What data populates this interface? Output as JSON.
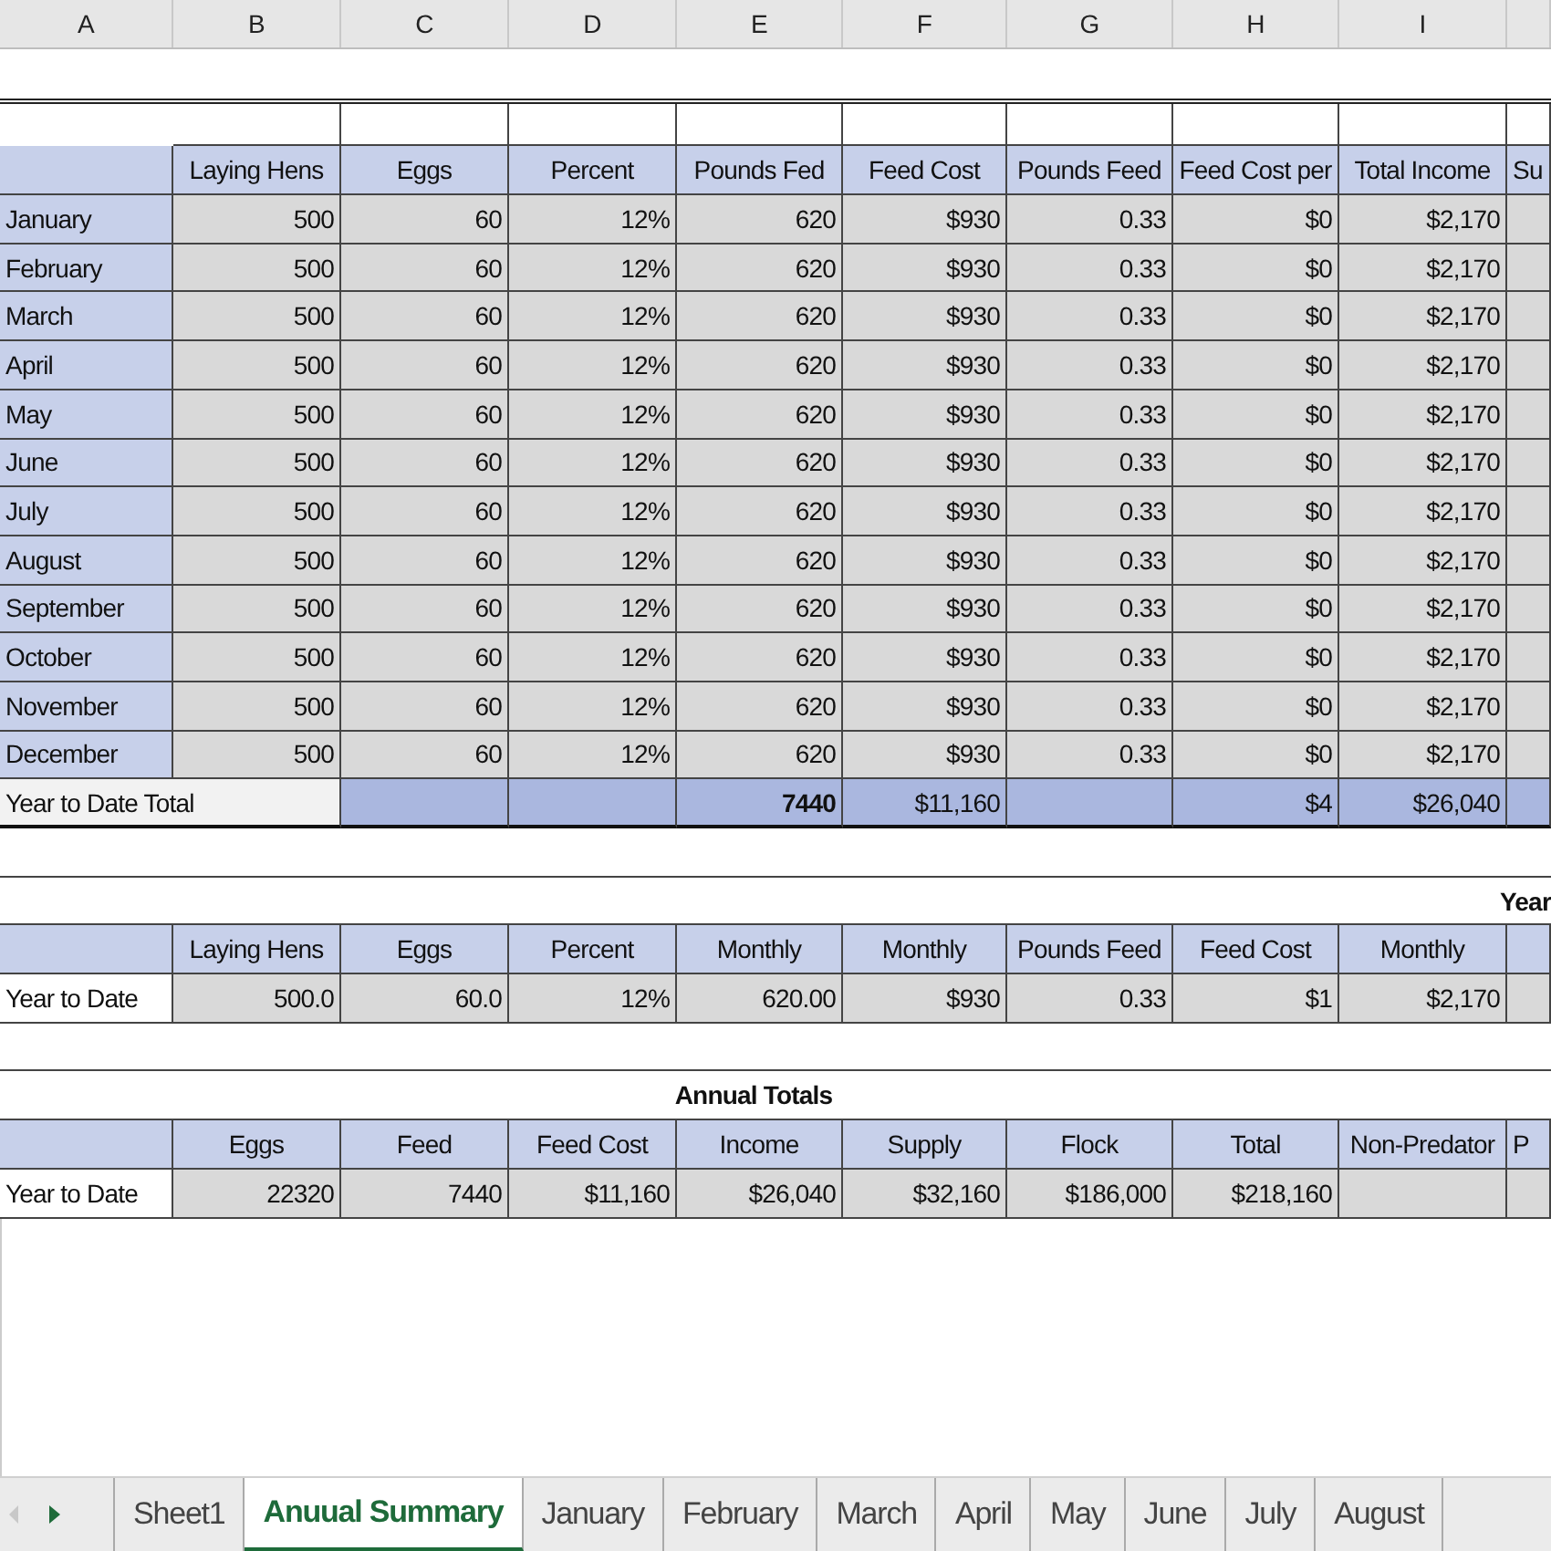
{
  "column_headers": [
    "A",
    "B",
    "C",
    "D",
    "E",
    "F",
    "G",
    "H",
    "I"
  ],
  "monthly_table": {
    "columns": [
      "Laying Hens",
      "Eggs",
      "Percent",
      "Pounds Fed",
      "Feed Cost",
      "Pounds Feed",
      "Feed Cost per",
      "Total Income",
      "Su"
    ],
    "rows": [
      {
        "label": "January",
        "values": [
          "500",
          "60",
          "12%",
          "620",
          "$930",
          "0.33",
          "$0",
          "$2,170"
        ]
      },
      {
        "label": "February",
        "values": [
          "500",
          "60",
          "12%",
          "620",
          "$930",
          "0.33",
          "$0",
          "$2,170"
        ]
      },
      {
        "label": "March",
        "values": [
          "500",
          "60",
          "12%",
          "620",
          "$930",
          "0.33",
          "$0",
          "$2,170"
        ]
      },
      {
        "label": "April",
        "values": [
          "500",
          "60",
          "12%",
          "620",
          "$930",
          "0.33",
          "$0",
          "$2,170"
        ]
      },
      {
        "label": "May",
        "values": [
          "500",
          "60",
          "12%",
          "620",
          "$930",
          "0.33",
          "$0",
          "$2,170"
        ]
      },
      {
        "label": "June",
        "values": [
          "500",
          "60",
          "12%",
          "620",
          "$930",
          "0.33",
          "$0",
          "$2,170"
        ]
      },
      {
        "label": "July",
        "values": [
          "500",
          "60",
          "12%",
          "620",
          "$930",
          "0.33",
          "$0",
          "$2,170"
        ]
      },
      {
        "label": "August",
        "values": [
          "500",
          "60",
          "12%",
          "620",
          "$930",
          "0.33",
          "$0",
          "$2,170"
        ]
      },
      {
        "label": "September",
        "values": [
          "500",
          "60",
          "12%",
          "620",
          "$930",
          "0.33",
          "$0",
          "$2,170"
        ]
      },
      {
        "label": "October",
        "values": [
          "500",
          "60",
          "12%",
          "620",
          "$930",
          "0.33",
          "$0",
          "$2,170"
        ]
      },
      {
        "label": "November",
        "values": [
          "500",
          "60",
          "12%",
          "620",
          "$930",
          "0.33",
          "$0",
          "$2,170"
        ]
      },
      {
        "label": "December",
        "values": [
          "500",
          "60",
          "12%",
          "620",
          "$930",
          "0.33",
          "$0",
          "$2,170"
        ]
      }
    ],
    "total": {
      "label": "Year to Date Total",
      "cells": {
        "E": {
          "text": "7440",
          "bold": true
        },
        "F": {
          "text": "$11,160",
          "bold": false
        },
        "H": {
          "text": "$4",
          "bold": false
        },
        "I": {
          "text": "$26,040",
          "bold": false
        }
      }
    }
  },
  "average_table": {
    "title": "Year",
    "columns": [
      "Laying Hens",
      "Eggs",
      "Percent",
      "Monthly",
      "Monthly",
      "Pounds Feed",
      "Feed Cost",
      "Monthly"
    ],
    "row": {
      "label": "Year to Date",
      "values": [
        "500.0",
        "60.0",
        "12%",
        "620.00",
        "$930",
        "0.33",
        "$1",
        "$2,170"
      ]
    }
  },
  "annual_totals": {
    "title": "Annual Totals",
    "columns": [
      "Eggs",
      "Feed",
      "Feed Cost",
      "Income",
      "Supply",
      "Flock",
      "Total",
      "Non-Predator",
      "P"
    ],
    "row": {
      "label": "Year to Date",
      "values": [
        "22320",
        "7440",
        "$11,160",
        "$26,040",
        "$32,160",
        "$186,000",
        "$218,160"
      ]
    }
  },
  "sheet_tabs": [
    {
      "label": "Sheet1",
      "selected": false
    },
    {
      "label": "Anuual Summary",
      "selected": true
    },
    {
      "label": "January",
      "selected": false
    },
    {
      "label": "February",
      "selected": false
    },
    {
      "label": "March",
      "selected": false
    },
    {
      "label": "April",
      "selected": false
    },
    {
      "label": "May",
      "selected": false
    },
    {
      "label": "June",
      "selected": false
    },
    {
      "label": "July",
      "selected": false
    },
    {
      "label": "August",
      "selected": false
    }
  ]
}
